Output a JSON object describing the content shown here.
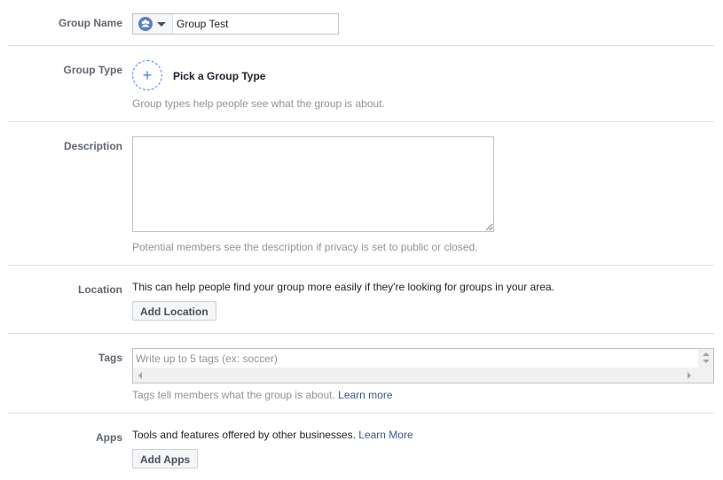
{
  "group_name": {
    "label": "Group Name",
    "icon": "group-icon",
    "value": "Group Test"
  },
  "group_type": {
    "label": "Group Type",
    "icon": "plus-icon",
    "pick_label": "Pick a Group Type",
    "help": "Group types help people see what the group is about."
  },
  "description": {
    "label": "Description",
    "value": "",
    "help": "Potential members see the description if privacy is set to public or closed."
  },
  "location": {
    "label": "Location",
    "text": "This can help people find your group more easily if they're looking for groups in your area.",
    "button": "Add Location"
  },
  "tags": {
    "label": "Tags",
    "placeholder": "Write up to 5 tags (ex: soccer)",
    "help": "Tags tell members what the group is about.",
    "learn_more": "Learn more"
  },
  "apps": {
    "label": "Apps",
    "text": "Tools and features offered by other businesses.",
    "learn_more": "Learn More",
    "button": "Add Apps"
  },
  "colors": {
    "accent": "#4080ff",
    "link": "#385898",
    "muted": "#90949c",
    "label": "#606770",
    "divider": "#dddfe2"
  }
}
